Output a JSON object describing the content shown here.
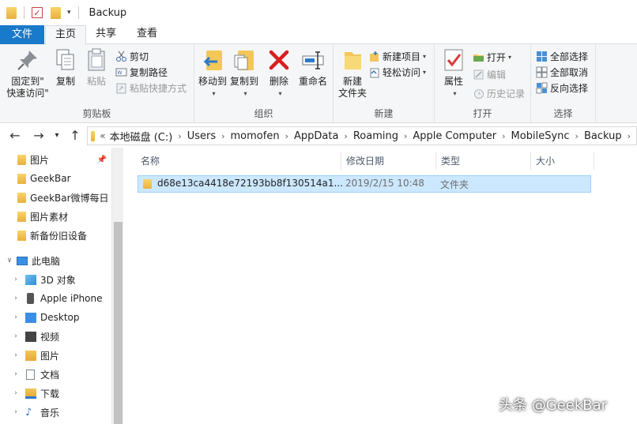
{
  "window": {
    "title": "Backup"
  },
  "tabs": {
    "file": "文件",
    "home": "主页",
    "share": "共享",
    "view": "查看"
  },
  "ribbon": {
    "clipboard": {
      "label": "剪贴板",
      "pin_line1": "固定到\"",
      "pin_line2": "快速访问\"",
      "copy": "复制",
      "paste": "粘贴",
      "cut": "剪切",
      "copy_path": "复制路径",
      "paste_shortcut": "粘贴快捷方式"
    },
    "organize": {
      "label": "组织",
      "move_to": "移动到",
      "copy_to": "复制到",
      "delete": "删除",
      "rename": "重命名"
    },
    "new": {
      "label": "新建",
      "new_folder_line1": "新建",
      "new_folder_line2": "文件夹",
      "new_item": "新建项目",
      "easy_access": "轻松访问"
    },
    "open": {
      "label": "打开",
      "properties": "属性",
      "open": "打开",
      "edit": "编辑",
      "history": "历史记录"
    },
    "select": {
      "label": "选择",
      "select_all": "全部选择",
      "select_none": "全部取消",
      "invert": "反向选择"
    }
  },
  "address": {
    "crumbs": [
      "本地磁盘 (C:)",
      "Users",
      "momofen",
      "AppData",
      "Roaming",
      "Apple Computer",
      "MobileSync",
      "Backup"
    ]
  },
  "nav": {
    "items": [
      {
        "label": "图片",
        "pinned": true
      },
      {
        "label": "GeekBar"
      },
      {
        "label": "GeekBar微博每日"
      },
      {
        "label": "图片素材"
      },
      {
        "label": "新备份旧设备"
      },
      {
        "label": "此电脑"
      },
      {
        "label": "3D 对象"
      },
      {
        "label": "Apple iPhone"
      },
      {
        "label": "Desktop"
      },
      {
        "label": "视频"
      },
      {
        "label": "图片"
      },
      {
        "label": "文档"
      },
      {
        "label": "下载"
      },
      {
        "label": "音乐"
      }
    ]
  },
  "columns": {
    "name": "名称",
    "modified": "修改日期",
    "type": "类型",
    "size": "大小"
  },
  "files": [
    {
      "name": "d68e13ca4418e72193bb8f130514a1...",
      "modified": "2019/2/15 10:48",
      "type": "文件夹",
      "size": ""
    }
  ],
  "watermark": "头条 @GeekBar"
}
